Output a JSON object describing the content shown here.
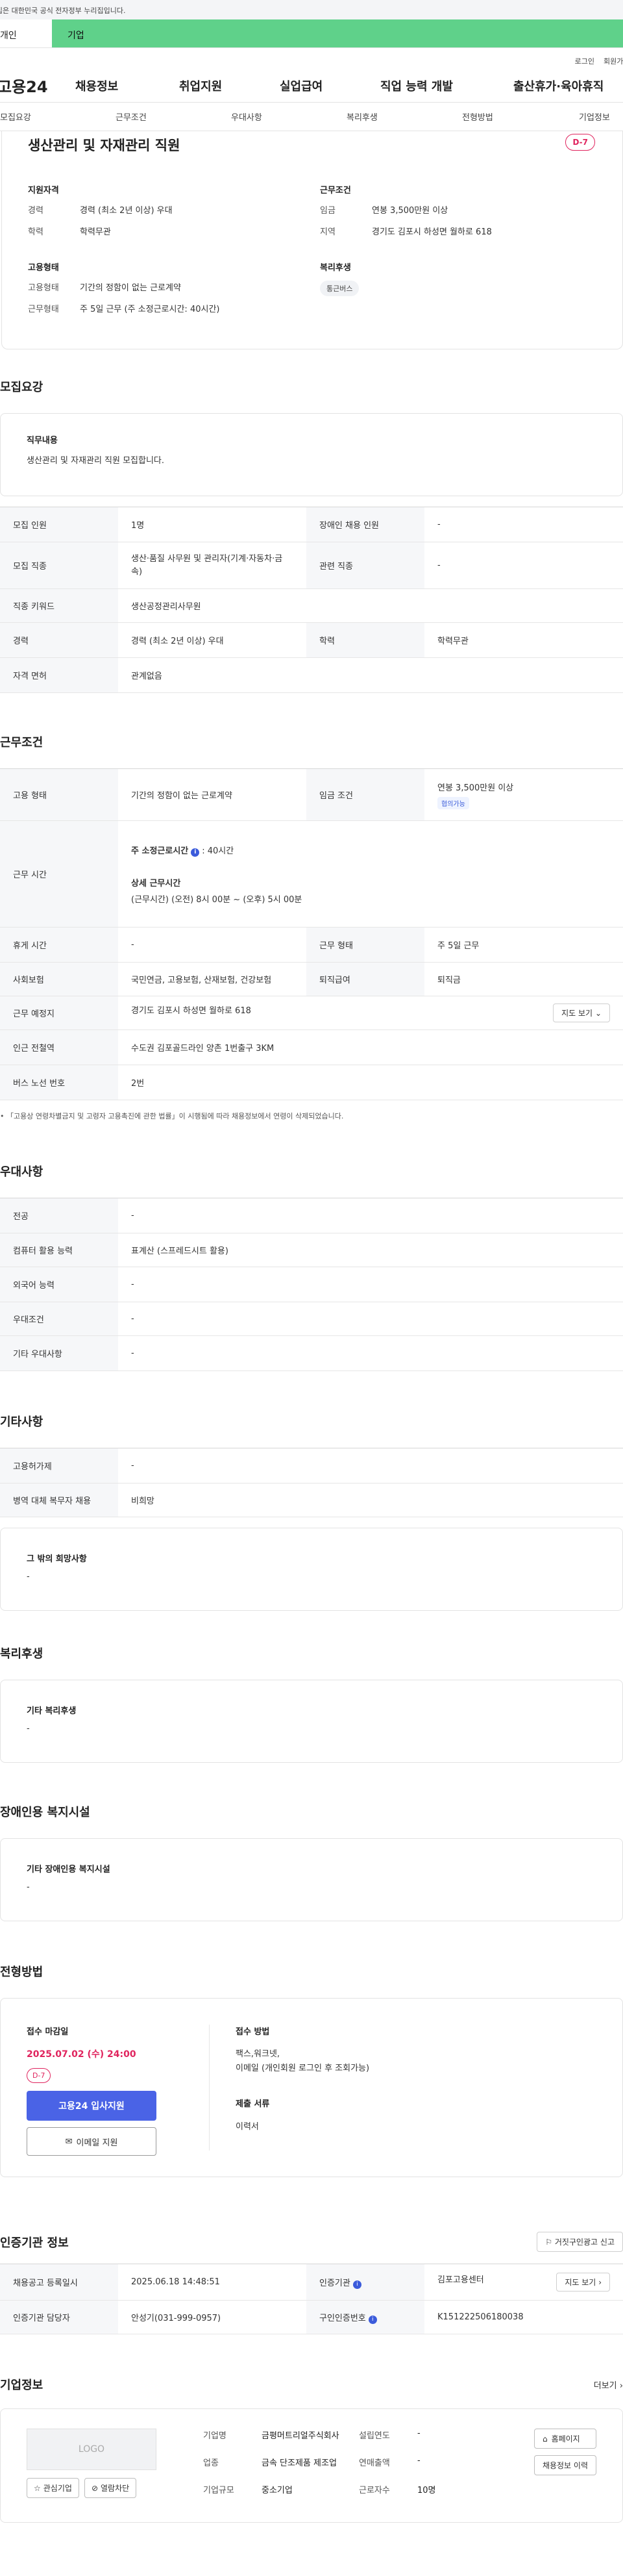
{
  "gov_banner": "이 누리집은 대한민국 공식 전자정부 누리집입니다.",
  "user_tabs": {
    "personal": "개인",
    "company": "기업"
  },
  "util_links": [
    "로그인",
    "회원가입"
  ],
  "gnb": {
    "logo": "고용24",
    "menu": [
      "채용정보",
      "취업지원",
      "실업급여",
      "직업 능력 개발",
      "출산휴가·육아휴직"
    ]
  },
  "anchor_nav": [
    "모집요강",
    "근무조건",
    "우대사항",
    "복리후생",
    "전형방법",
    "기업정보"
  ],
  "summary": {
    "title": "생산관리 및 자재관리 직원",
    "dday": "D-7",
    "qualification": {
      "title": "지원자격",
      "rows": [
        {
          "k": "경력",
          "v": "경력 (최소 2년 이상) 우대"
        },
        {
          "k": "학력",
          "v": "학력무관"
        }
      ]
    },
    "employment": {
      "title": "고용형태",
      "rows": [
        {
          "k": "고용형태",
          "v": "기간의 정함이 없는 근로계약"
        },
        {
          "k": "근무형태",
          "v": "주 5일 근무 (주 소정근로시간: 40시간)"
        }
      ]
    },
    "conditions": {
      "title": "근무조건",
      "rows": [
        {
          "k": "임금",
          "v": "연봉 3,500만원 이상"
        },
        {
          "k": "지역",
          "v": "경기도 김포시 하성면 월하로 618"
        }
      ]
    },
    "welfare": {
      "title": "복리후생",
      "tag": "통근버스"
    }
  },
  "recruit": {
    "title": "모집요강",
    "duty_title": "직무내용",
    "duty_text": "생산관리 및 자재관리 직원 모집합니다.",
    "table": {
      "headcount_k": "모집 인원",
      "headcount_v": "1명",
      "disabled_k": "장애인 채용 인원",
      "disabled_v": "-",
      "job_k": "모집 직종",
      "job_v": "생산·품질 사무원 및 관리자(기계·자동차·금속)",
      "related_k": "관련 직종",
      "related_v": "-",
      "keyword_k": "직종 키워드",
      "keyword_v": "생산공정관리사무원",
      "career_k": "경력",
      "career_v": "경력 (최소 2년 이상) 우대",
      "edu_k": "학력",
      "edu_v": "학력무관",
      "license_k": "자격 면허",
      "license_v": "관계없음"
    }
  },
  "work": {
    "title": "근무조건",
    "type_k": "고용 형태",
    "type_v": "기간의 정함이 없는 근로계약",
    "wage_k": "임금 조건",
    "wage_v": "연봉 3,500만원 이상",
    "wage_tag": "협의가능",
    "hours_k": "근무 시간",
    "hours_label": "주 소정근로시간",
    "hours_value": ": 40시간",
    "hours_detail_title": "상세 근무시간",
    "hours_detail": "(근무시간) (오전) 8시 00분 ~ (오후) 5시 00분",
    "rest_k": "휴게 시간",
    "rest_v": "-",
    "shift_k": "근무 형태",
    "shift_v": "주 5일 근무",
    "insurance_k": "사회보험",
    "insurance_v": "국민연금, 고용보험, 산재보험, 건강보험",
    "severance_k": "퇴직급여",
    "severance_v": "퇴직금",
    "place_k": "근무 예정지",
    "place_v": "경기도 김포시 하성면 월하로 618",
    "map_btn": "지도 보기",
    "subway_k": "인근 전철역",
    "subway_v": "수도권 김포골드라인 양촌 1번출구 3KM",
    "bus_k": "버스 노선 번호",
    "bus_v": "2번",
    "footnote": "「고용상 연령차별금지 및 고령자 고용촉진에 관한 법률」이 시행됨에 따라 채용정보에서 연령이 삭제되었습니다."
  },
  "preference": {
    "title": "우대사항",
    "rows": [
      {
        "k": "전공",
        "v": "-"
      },
      {
        "k": "컴퓨터 활용 능력",
        "v": "표계산 (스프레드시트 활용)"
      },
      {
        "k": "외국어 능력",
        "v": "-"
      },
      {
        "k": "우대조건",
        "v": "-"
      },
      {
        "k": "기타 우대사항",
        "v": "-"
      }
    ]
  },
  "etc": {
    "title": "기타사항",
    "rows": [
      {
        "k": "고용허가제",
        "v": "-"
      },
      {
        "k": "병역 대체 복무자 채용",
        "v": "비희망"
      }
    ],
    "box_title": "그 밖의 희망사항",
    "box_text": "-"
  },
  "welfare": {
    "title": "복리후생",
    "box_title": "기타 복리후생",
    "box_text": "-"
  },
  "disabled_facility": {
    "title": "장애인용 복지시설",
    "box_title": "기타 장애인용 복지시설",
    "box_text": "-"
  },
  "method": {
    "title": "전형방법",
    "deadline_label": "접수 마감일",
    "deadline_date": "2025.07.02 (수) 24:00",
    "dday": "D-7",
    "apply_btn": "고용24 입사지원",
    "email_btn": "이메일 지원",
    "accept_label": "접수 방법",
    "accept_text": "팩스,워크넷,\n이메일 (개인회원 로그인 후 조회가능)",
    "docs_label": "제출 서류",
    "docs_text": "이력서"
  },
  "cert": {
    "title": "인증기관 정보",
    "report_btn": "거짓구인광고 신고",
    "reg_k": "채용공고 등록일시",
    "reg_v": "2025.06.18 14:48:51",
    "org_k": "인증기관",
    "org_v": "김포고용센터",
    "map_btn": "지도 보기",
    "mgr_k": "인증기관 담당자",
    "mgr_v": "안성기(031-999-0957)",
    "no_k": "구인인증번호",
    "no_v": "K151222506180038"
  },
  "company": {
    "title": "기업정보",
    "more": "더보기",
    "logo_text": "LOGO",
    "fav_btn": "관심기업",
    "block_btn": "열람차단",
    "name_k": "기업명",
    "name_v": "금평머트리얼주식회사",
    "year_k": "설립연도",
    "year_v": "-",
    "industry_k": "업종",
    "industry_v": "금속 단조제품 제조업",
    "sales_k": "연매출액",
    "sales_v": "-",
    "size_k": "기업규모",
    "size_v": "중소기업",
    "staff_k": "근로자수",
    "staff_v": "10명",
    "homepage_btn": "홈페이지",
    "history_btn": "채용정보 이력"
  }
}
